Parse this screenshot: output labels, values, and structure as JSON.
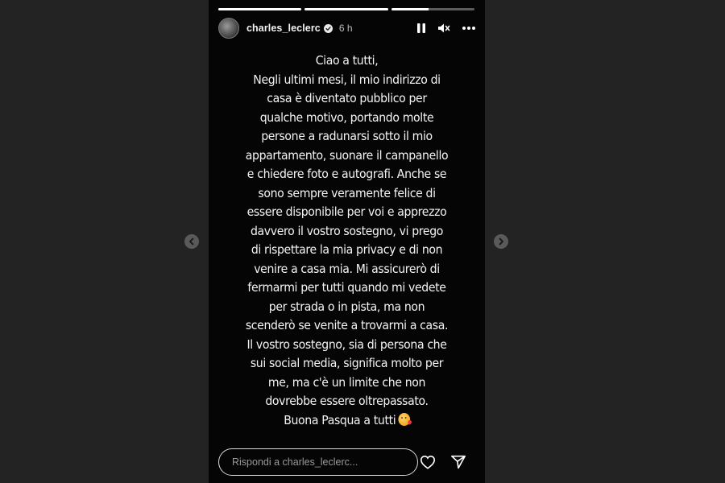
{
  "story": {
    "progress": [
      1,
      1,
      0.45
    ],
    "user": {
      "username": "charles_leclerc",
      "time": "6 h"
    },
    "message_lines": [
      "Ciao a tutti,",
      "Negli ultimi mesi, il mio indirizzo di",
      "casa è diventato pubblico per",
      "qualche motivo, portando molte",
      "persone a radunarsi sotto il mio",
      "appartamento, suonare il campanello",
      "e chiedere foto e autografi. Anche se",
      "sono sempre veramente felice di",
      "essere disponibile per voi e apprezzo",
      "davvero il vostro sostegno, vi prego",
      "di rispettare la mia privacy e di non",
      "venire a casa mia. Mi assicurerò di",
      "fermarmi per tutti quando mi vedete",
      "per strada o in pista, ma non",
      "scenderò se venite a trovarmi a casa.",
      "Il vostro sostegno, sia di persona che",
      "sui social media, significa molto per",
      "me, ma c'è un limite che non",
      "dovrebbe essere oltrepassato.",
      "Buona Pasqua a tutti"
    ],
    "reply_placeholder": "Rispondi a charles_leclerc...",
    "icons": {
      "pause": "pause-icon",
      "mute": "mute-icon",
      "more": "more-options-icon",
      "like": "heart-icon",
      "share": "send-icon",
      "emoji": "kissing-face-icon",
      "verified": "verified-badge-icon",
      "prev": "chevron-left-icon",
      "next": "chevron-right-icon"
    }
  }
}
